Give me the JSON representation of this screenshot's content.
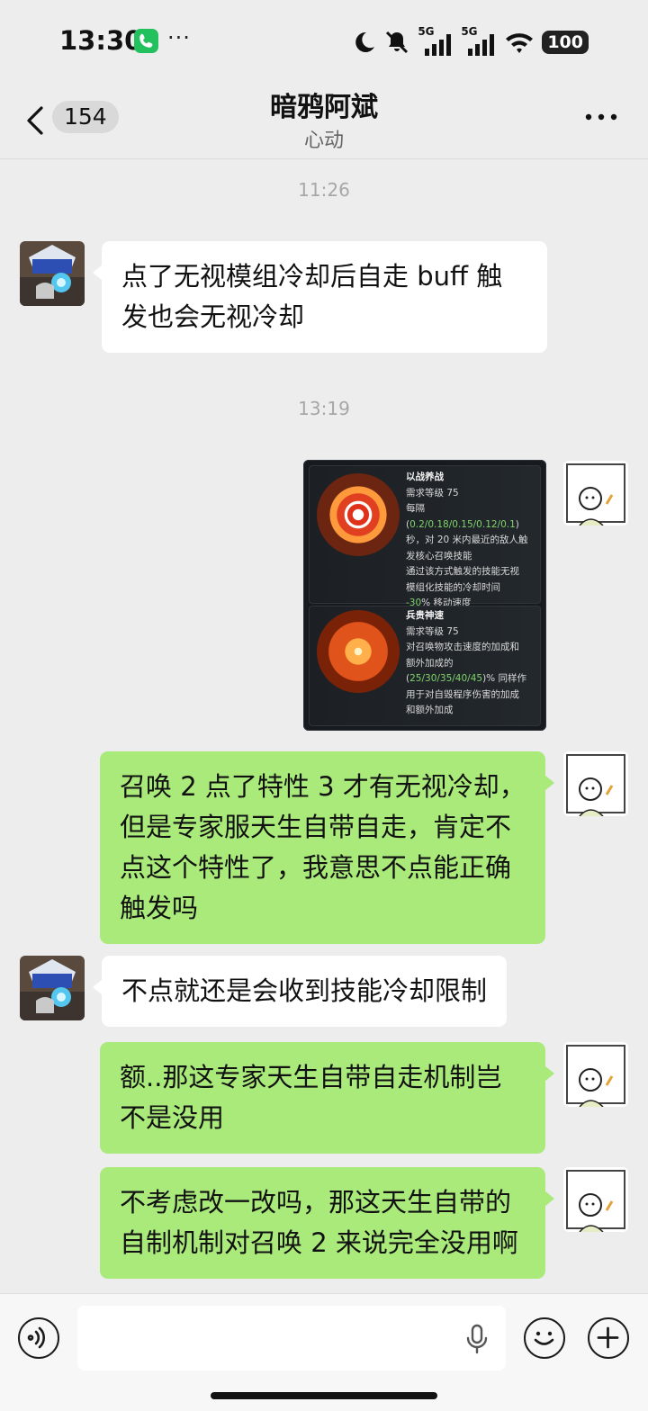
{
  "status_bar": {
    "time": "13:30",
    "dots": "···",
    "signal_labels": [
      "5G",
      "5G"
    ],
    "battery": "100",
    "icons": [
      "phone-icon",
      "moon-icon",
      "mute-bell-icon",
      "signal-icon",
      "wifi-icon",
      "battery-icon"
    ]
  },
  "header": {
    "unread_count": "154",
    "title": "暗鸦阿斌",
    "subtitle": "心动"
  },
  "messages": {
    "ts1": "11:26",
    "m1": "点了无视模组冷却后自走 buff 触发也会无视冷却",
    "ts2": "13:19",
    "skill": {
      "s1_name": "以战养战",
      "s1_level": "需求等级 75",
      "s1_line1_pre": "每隔 (",
      "s1_line1_val": "0.2/0.18/0.15/0.12/0.1",
      "s1_line1_post": ")",
      "s1_line2": "秒，对 20 米内最近的敌人触",
      "s1_line3": "发核心召唤技能",
      "s1_line4": "通过该方式触发的技能无视",
      "s1_line5": "模组化技能的冷却时间",
      "s1_line6_val": "-30",
      "s1_line6_post": "% 移动速度",
      "s2_name": "兵贵神速",
      "s2_level": "需求等级 75",
      "s2_line1": "对召唤物攻击速度的加成和",
      "s2_line2": "额外加成的",
      "s2_line3_pre": "(",
      "s2_line3_val": "25/30/35/40/45",
      "s2_line3_post": ")% 同样作",
      "s2_line4": "用于对自毁程序伤害的加成",
      "s2_line5": "和额外加成"
    },
    "m3": "召唤 2 点了特性 3 才有无视冷却，但是专家服天生自带自走，肯定不点这个特性了，我意思不点能正确触发吗",
    "m4": "不点就还是会收到技能冷却限制",
    "m5": "额..那这专家天生自带自走机制岂不是没用",
    "m6": "不考虑改一改吗，那这天生自带的自制机制对召唤 2 来说完全没用啊"
  },
  "input_bar": {
    "placeholder": "",
    "icons": [
      "voice-icon",
      "mic-icon",
      "emoji-icon",
      "plus-icon"
    ]
  },
  "colors": {
    "background": "#ededed",
    "incoming_bubble": "#ffffff",
    "outgoing_bubble": "#a9ea7a",
    "timestamp": "#a7a7a7",
    "skill_highlight": "#7fd36a"
  }
}
